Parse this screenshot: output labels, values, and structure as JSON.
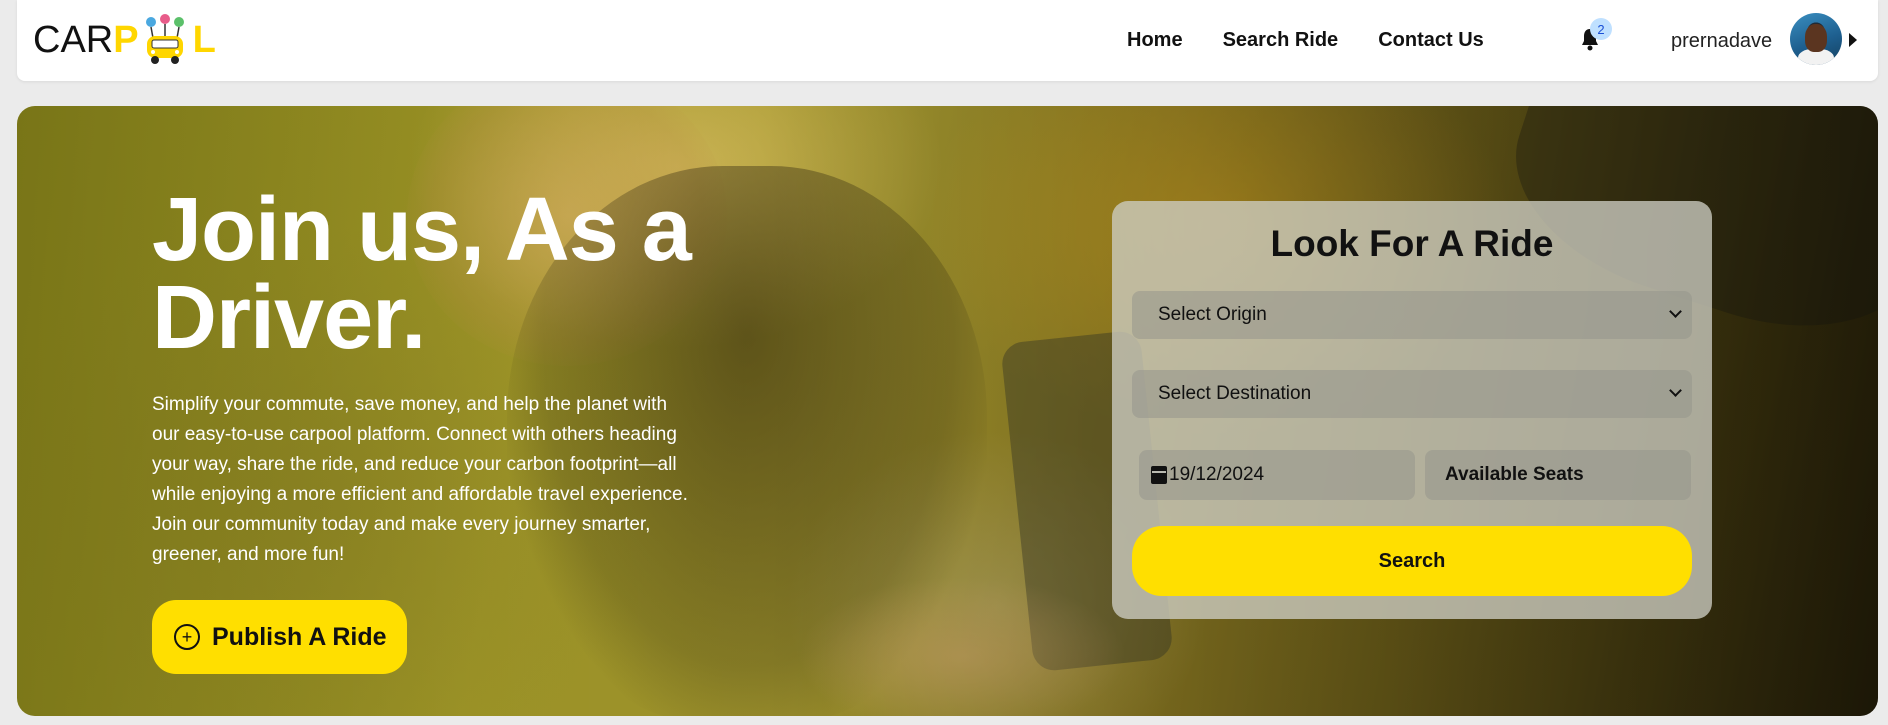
{
  "brand": {
    "logo_left": "CAR",
    "logo_p": "P",
    "logo_l": "L",
    "accent_color": "#ffdf00"
  },
  "nav": {
    "links": [
      "Home",
      "Search Ride",
      "Contact Us"
    ],
    "notifications_count": "2",
    "username": "prernadave",
    "bell_icon": "bell-icon",
    "caret_icon": "caret-right-icon"
  },
  "hero": {
    "title": "Join us, As a Driver.",
    "description": "Simplify your commute, save money, and help the planet with our easy-to-use carpool platform. Connect with others heading your way, share the ride, and reduce your carbon footprint—all while enjoying a more efficient and affordable travel experience. Join our community today and make every journey smarter, greener, and more fun!",
    "publish_button": "Publish A Ride",
    "publish_icon": "plus-circle-icon"
  },
  "search_card": {
    "title": "Look For A Ride",
    "origin_select": "Select Origin",
    "destination_select": "Select Destination",
    "date_value": "19/12/2024",
    "seats_placeholder": "Available Seats",
    "search_button": "Search",
    "calendar_icon": "calendar-icon"
  }
}
